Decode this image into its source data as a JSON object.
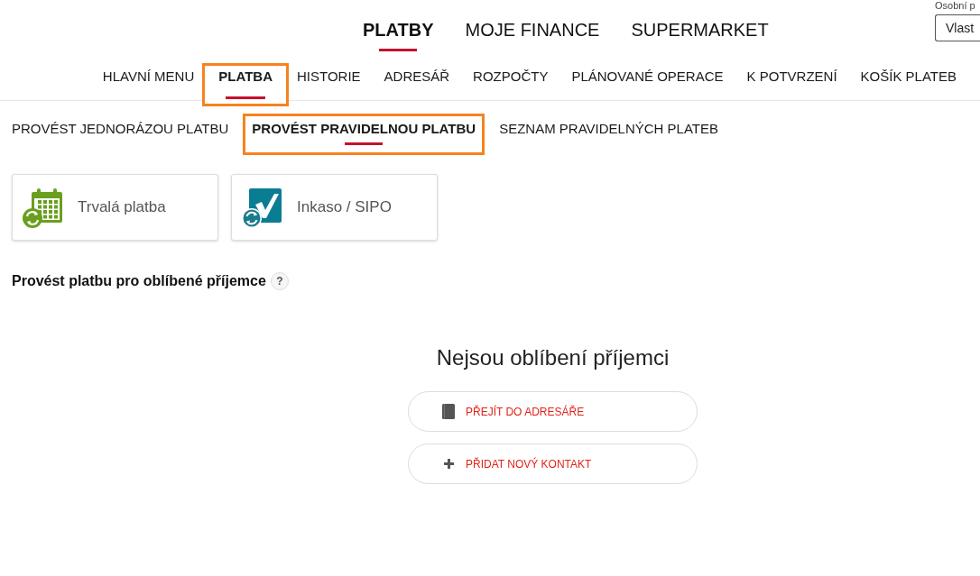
{
  "account": {
    "label": "Osobní p",
    "button": "Vlast"
  },
  "main_nav": [
    {
      "label": "PLATBY",
      "selected": true
    },
    {
      "label": "MOJE FINANCE",
      "selected": false
    },
    {
      "label": "SUPERMARKET",
      "selected": false
    }
  ],
  "sub_nav": [
    {
      "label": "HLAVNÍ MENU",
      "selected": false,
      "highlighted": false
    },
    {
      "label": "PLATBA",
      "selected": true,
      "highlighted": true
    },
    {
      "label": "HISTORIE",
      "selected": false,
      "highlighted": false
    },
    {
      "label": "ADRESÁŘ",
      "selected": false,
      "highlighted": false
    },
    {
      "label": "ROZPOČTY",
      "selected": false,
      "highlighted": false
    },
    {
      "label": "PLÁNOVANÉ OPERACE",
      "selected": false,
      "highlighted": false
    },
    {
      "label": "K POTVRZENÍ",
      "selected": false,
      "highlighted": false
    },
    {
      "label": "KOŠÍK PLATEB",
      "selected": false,
      "highlighted": false
    }
  ],
  "section_tabs": [
    {
      "label": "PROVÉST JEDNORÁZOU PLATBU",
      "selected": false,
      "highlighted": false
    },
    {
      "label": "PROVÉST PRAVIDELNOU PLATBU",
      "selected": true,
      "highlighted": true
    },
    {
      "label": "SEZNAM PRAVIDELNÝCH PLATEB",
      "selected": false,
      "highlighted": false
    }
  ],
  "payment_types": [
    {
      "kind": "standing_order",
      "label": "Trvalá platba"
    },
    {
      "kind": "direct_debit",
      "label": "Inkaso / SIPO"
    }
  ],
  "favorites": {
    "title": "Provést platbu pro oblíbené příjemce",
    "help": "?",
    "empty_message": "Nejsou oblíbení příjemci",
    "actions": [
      {
        "kind": "address_book",
        "label": "PŘEJÍT DO ADRESÁŘE"
      },
      {
        "kind": "add",
        "label": "PŘIDAT NOVÝ KONTAKT"
      }
    ]
  }
}
